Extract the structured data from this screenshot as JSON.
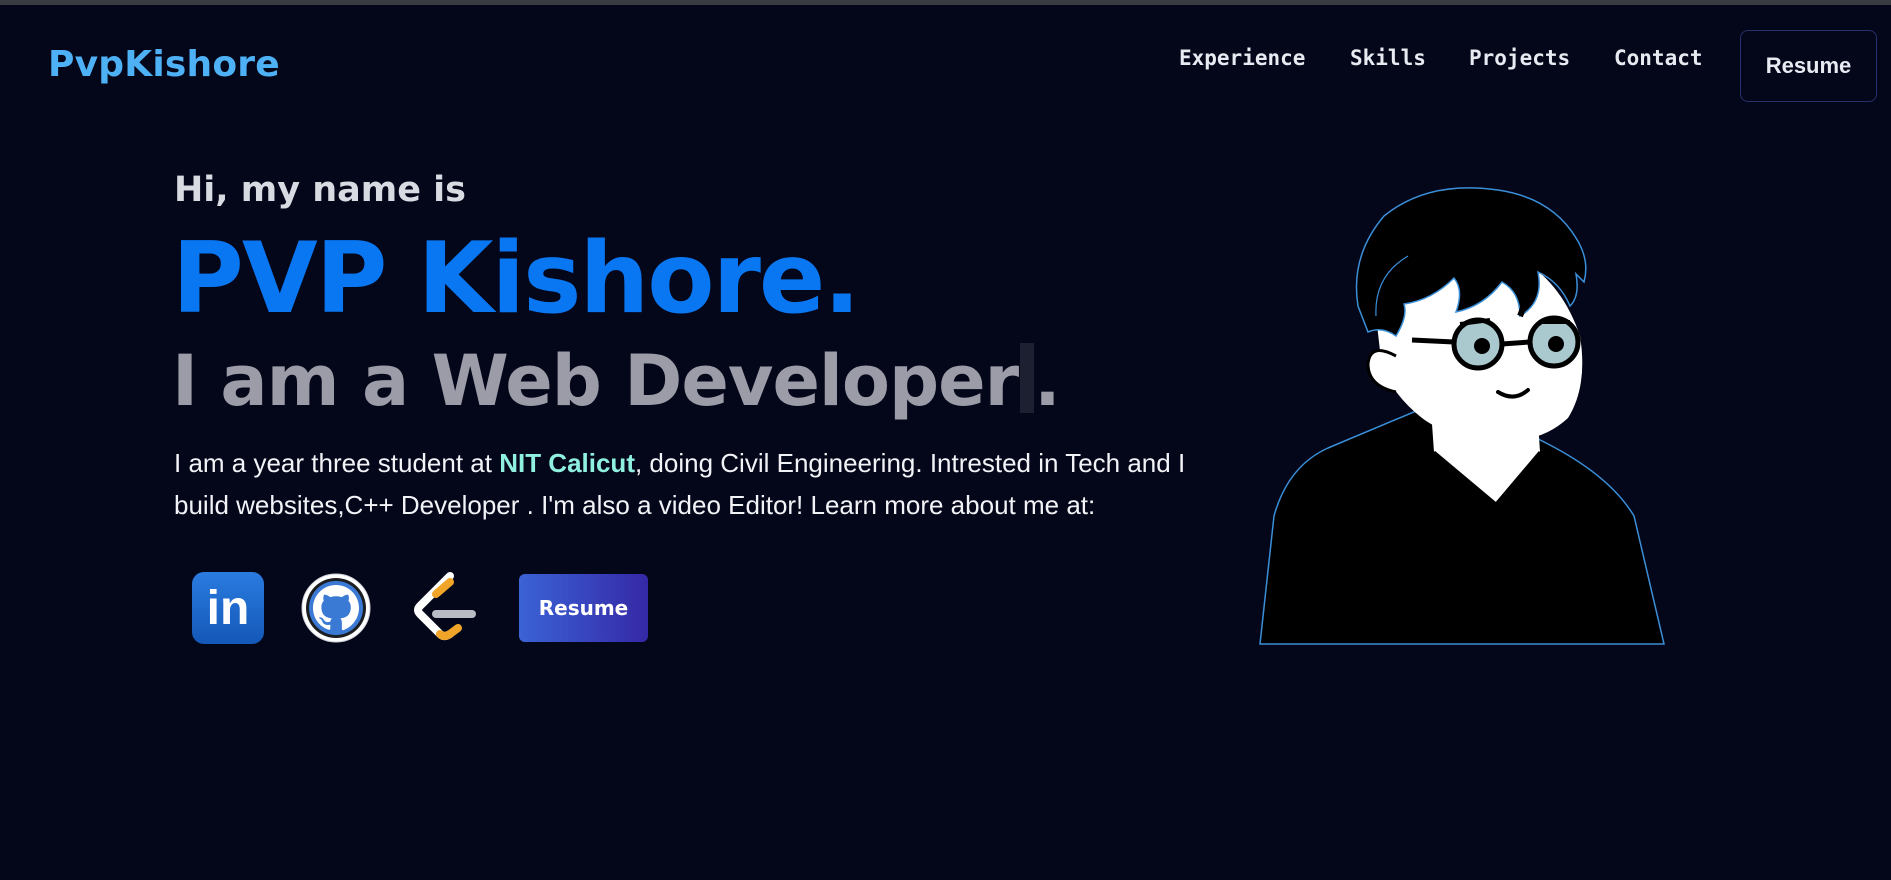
{
  "nav": {
    "brand": "PvpKishore",
    "links": [
      "Experience",
      "Skills",
      "Projects",
      "Contact"
    ],
    "resume_label": "Resume"
  },
  "hero": {
    "greeting": "Hi, my name is",
    "name": "PVP Kishore.",
    "role_text": "I am a Web Developer",
    "role_end": ".",
    "bio_part1": "I am a year three student at ",
    "bio_highlight": "NIT Calicut",
    "bio_part2": ", doing Civil Engineering. Intrested in Tech and I build websites,C++ Developer . I'm also a video Editor! Learn more about me at:",
    "resume_button": "Resume"
  },
  "social": {
    "linkedin_text": "in",
    "icons": [
      "linkedin-icon",
      "github-icon",
      "leetcode-icon"
    ]
  },
  "colors": {
    "background": "#04061a",
    "brand": "#4fb1f5",
    "name": "#0a77f2",
    "highlight": "#8ff0df"
  }
}
